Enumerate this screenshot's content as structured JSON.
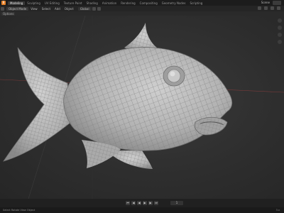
{
  "topbar": {
    "logo": "B",
    "workspaces": [
      "Modeling",
      "Sculpting",
      "UV Editing",
      "Texture Paint",
      "Shading",
      "Animation",
      "Rendering",
      "Compositing",
      "Geometry Nodes",
      "Scripting"
    ],
    "active_workspace": "Modeling",
    "scene": "Scene"
  },
  "header": {
    "mode": "Object Mode",
    "menus": [
      "View",
      "Select",
      "Add",
      "Object"
    ],
    "transform": "Global"
  },
  "toolbar2": {
    "pill": "Options"
  },
  "timeline": {
    "buttons": [
      "⏮",
      "◀",
      "◀",
      "▶",
      "▶",
      "⏭"
    ],
    "frame": "1"
  },
  "statusbar": {
    "left": "Select   Rotate View   Object",
    "version": "3.x"
  },
  "colors": {
    "viewport_bg": "#2e2e2e",
    "mesh": "#b9b9b9",
    "wire": "#7b7b7b",
    "accent": "#e8832a"
  }
}
